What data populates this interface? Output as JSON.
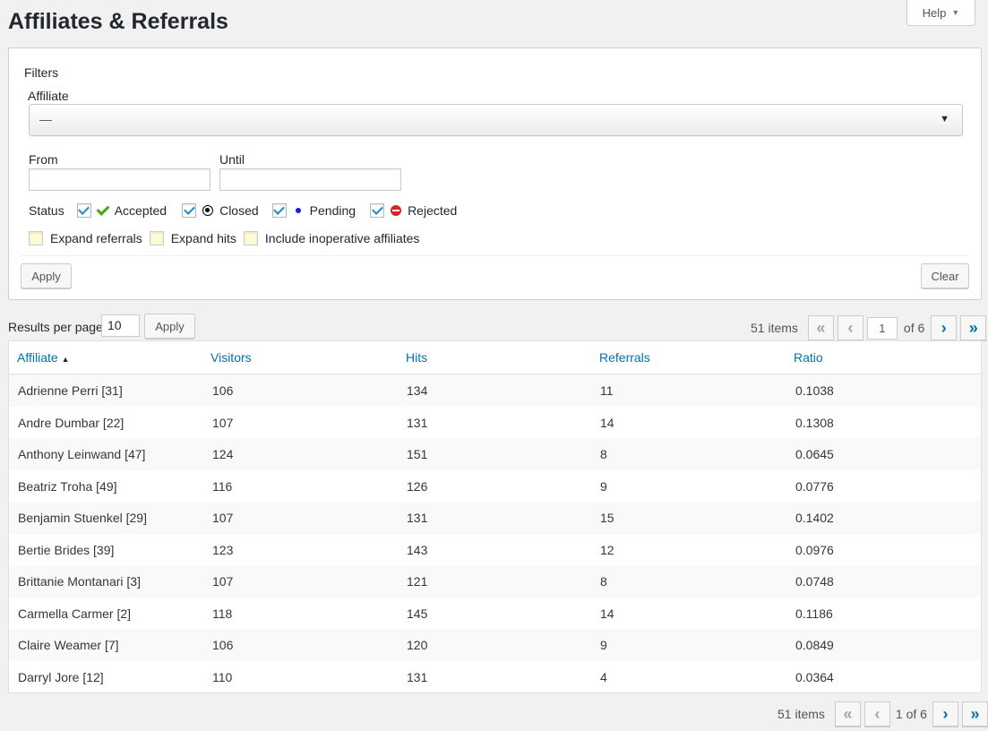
{
  "page": {
    "title": "Affiliates & Referrals",
    "help_label": "Help"
  },
  "filters": {
    "title": "Filters",
    "affiliate_label": "Affiliate",
    "affiliate_value": "—",
    "from_label": "From",
    "until_label": "Until",
    "status_label": "Status",
    "statuses": [
      {
        "label": "Accepted",
        "checked": true,
        "icon": "checkmark-icon",
        "color": "#48a51c"
      },
      {
        "label": "Closed",
        "checked": true,
        "icon": "closed-circle-icon",
        "color": "#000000"
      },
      {
        "label": "Pending",
        "checked": true,
        "icon": "pending-dot-icon",
        "color": "#1a1ae8"
      },
      {
        "label": "Rejected",
        "checked": true,
        "icon": "rejected-icon",
        "color": "#d3262a"
      }
    ],
    "options": [
      {
        "label": "Expand referrals",
        "checked": false
      },
      {
        "label": "Expand hits",
        "checked": false
      },
      {
        "label": "Include inoperative affiliates",
        "checked": false
      }
    ],
    "apply_label": "Apply",
    "clear_label": "Clear"
  },
  "results": {
    "per_page_label": "Results per page",
    "per_page_value": "10",
    "apply_label": "Apply"
  },
  "pagination": {
    "items_text": "51 items",
    "current_page": "1",
    "of_text": "of 6",
    "bottom_page_text": "1 of 6",
    "first": "«",
    "prev": "‹",
    "next": "›",
    "last": "»"
  },
  "table": {
    "columns": [
      "Affiliate",
      "Visitors",
      "Hits",
      "Referrals",
      "Ratio"
    ],
    "sort_indicator": "▲",
    "rows": [
      [
        "Adrienne Perri [31]",
        "106",
        "134",
        "11",
        "0.1038"
      ],
      [
        "Andre Dumbar [22]",
        "107",
        "131",
        "14",
        "0.1308"
      ],
      [
        "Anthony Leinwand [47]",
        "124",
        "151",
        "8",
        "0.0645"
      ],
      [
        "Beatriz Troha [49]",
        "116",
        "126",
        "9",
        "0.0776"
      ],
      [
        "Benjamin Stuenkel [29]",
        "107",
        "131",
        "15",
        "0.1402"
      ],
      [
        "Bertie Brides [39]",
        "123",
        "143",
        "12",
        "0.0976"
      ],
      [
        "Brittanie Montanari [3]",
        "107",
        "121",
        "8",
        "0.0748"
      ],
      [
        "Carmella Carmer [2]",
        "118",
        "145",
        "14",
        "0.1186"
      ],
      [
        "Claire Weamer [7]",
        "106",
        "120",
        "9",
        "0.0849"
      ],
      [
        "Darryl Jore [12]",
        "110",
        "131",
        "4",
        "0.0364"
      ]
    ]
  }
}
